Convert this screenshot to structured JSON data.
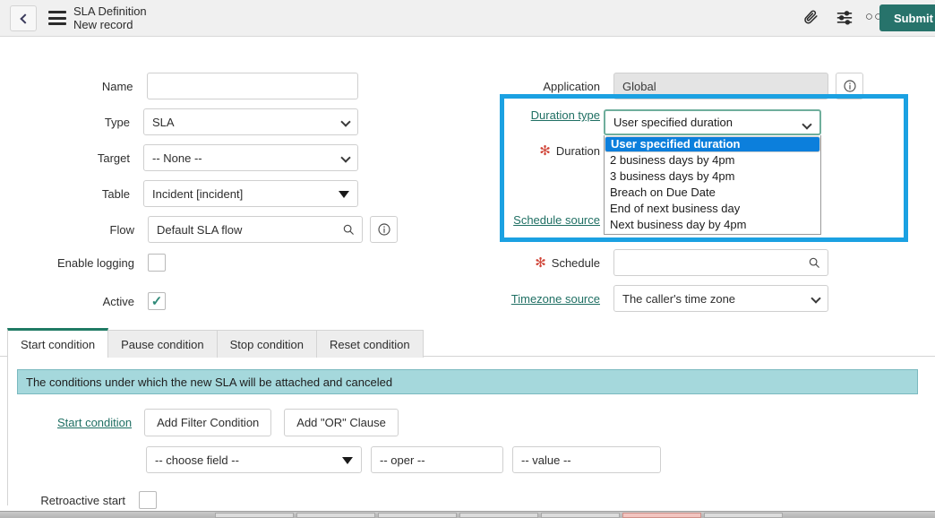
{
  "header": {
    "back_icon": "chevron-left-icon",
    "menu_icon": "hamburger-menu-icon",
    "title": "SLA Definition",
    "subtitle": "New record",
    "attachment_icon": "paperclip-icon",
    "personalize_icon": "sliders-icon",
    "more_icon": "more-options-icon",
    "submit_label": "Submit"
  },
  "form": {
    "left": {
      "name_label": "Name",
      "name_value": "",
      "type_label": "Type",
      "type_value": "SLA",
      "target_label": "Target",
      "target_value": "-- None --",
      "table_label": "Table",
      "table_value": "Incident [incident]",
      "flow_label": "Flow",
      "flow_value": "Default SLA flow",
      "flow_search_icon": "magnifier-icon",
      "flow_info_icon": "info-circle-icon",
      "enable_logging_label": "Enable logging",
      "enable_logging_checked": false,
      "active_label": "Active",
      "active_checked": true,
      "active_tick": "✓"
    },
    "right": {
      "application_label": "Application",
      "application_value": "Global",
      "application_info_icon": "info-circle-icon",
      "duration_type_label": "Duration type",
      "duration_type_value": "User specified duration",
      "duration_label": "Duration",
      "duration_required": "✻",
      "schedule_source_label": "Schedule source",
      "schedule_label": "Schedule",
      "schedule_required": "✻",
      "schedule_value": "",
      "schedule_search_icon": "magnifier-icon",
      "timezone_source_label": "Timezone source",
      "timezone_source_value": "The caller's time zone"
    }
  },
  "dropdown": {
    "open": true,
    "selected_value": "User specified duration",
    "options": [
      "User specified duration",
      "2 business days by 4pm",
      "3 business days by 4pm",
      "Breach on Due Date",
      "End of next business day",
      "Next business day by 4pm"
    ],
    "selected_index": 0,
    "highlight_color": "#0c7fdc"
  },
  "annotation": {
    "shape": "rectangle-highlight",
    "color": "#1ba1e2"
  },
  "tabs": [
    {
      "label": "Start condition",
      "active": true
    },
    {
      "label": "Pause condition",
      "active": false
    },
    {
      "label": "Stop condition",
      "active": false
    },
    {
      "label": "Reset condition",
      "active": false
    }
  ],
  "panel": {
    "banner_text": "The conditions under which the new SLA will be attached and canceled",
    "banner_color": "#a5d8dc",
    "start_condition_link": "Start condition",
    "add_filter_label": "Add Filter Condition",
    "add_or_label": "Add \"OR\" Clause",
    "filter": {
      "field_value": "-- choose field --",
      "oper_value": "-- oper --",
      "value_value": "-- value --"
    },
    "retroactive_label": "Retroactive start",
    "retroactive_checked": false
  },
  "theme": {
    "accent_green": "#27736b",
    "link_teal": "#1f6f63",
    "required_red": "#d04437",
    "annotation_blue": "#1ba1e2"
  }
}
